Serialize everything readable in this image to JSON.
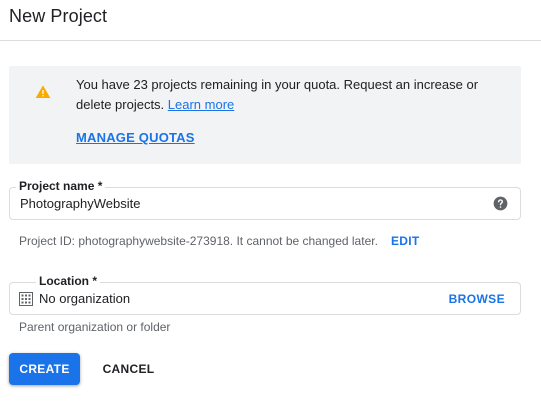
{
  "header": {
    "title": "New Project"
  },
  "notice": {
    "icon": "warning-icon",
    "text_before_link": "You have 23 projects remaining in your quota. Request an increase or delete projects. ",
    "learn_more_label": "Learn more",
    "manage_quotas_label": "MANAGE QUOTAS"
  },
  "project_name": {
    "label": "Project name *",
    "value": "PhotographyWebsite",
    "help_icon": "help-circle-icon",
    "project_id_hint": "Project ID: photographywebsite-273918. It cannot be changed later.",
    "edit_label": "EDIT"
  },
  "location": {
    "label": "Location *",
    "icon": "building-icon",
    "value": "No organization",
    "browse_label": "BROWSE",
    "hint": "Parent organization or folder"
  },
  "actions": {
    "create_label": "CREATE",
    "cancel_label": "CANCEL"
  },
  "colors": {
    "accent": "#1a73e8",
    "warning": "#f9ab00",
    "notice_bg": "#f1f3f4",
    "border": "#dadce0"
  }
}
